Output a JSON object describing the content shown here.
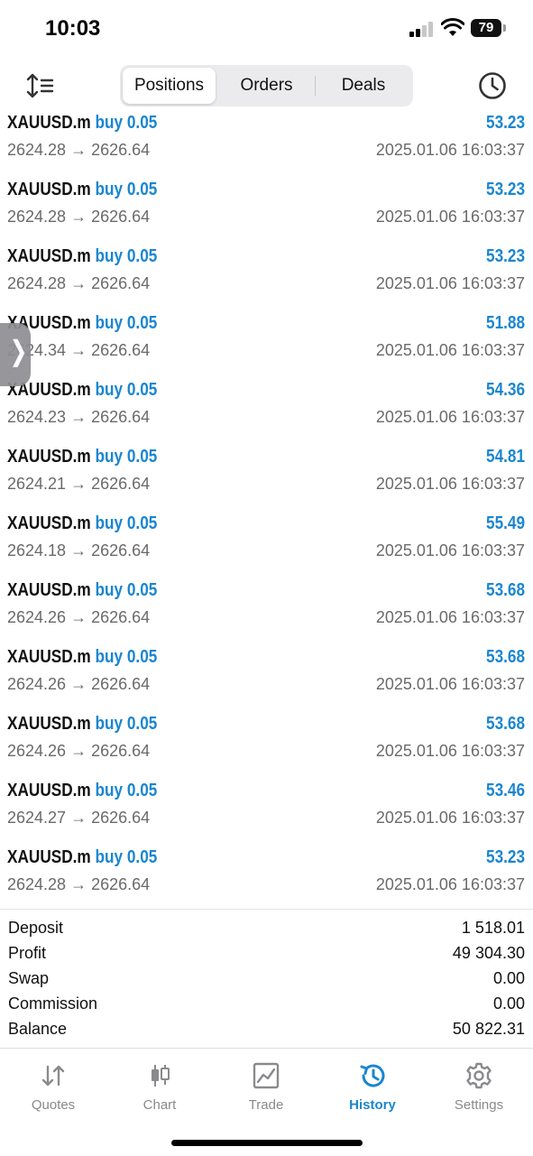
{
  "status_bar": {
    "time": "10:03",
    "battery": "79"
  },
  "toolbar": {
    "segments": [
      {
        "label": "Positions",
        "active": true
      },
      {
        "label": "Orders",
        "active": false
      },
      {
        "label": "Deals",
        "active": false
      }
    ]
  },
  "accent_color": "#1a86d0",
  "deals": [
    {
      "symbol": "XAUUSD.m",
      "side": "buy 0.05",
      "prices": "2624.28 → 2626.64",
      "profit": "53.23",
      "time": "2025.01.06 16:03:37"
    },
    {
      "symbol": "XAUUSD.m",
      "side": "buy 0.05",
      "prices": "2624.28 → 2626.64",
      "profit": "53.23",
      "time": "2025.01.06 16:03:37"
    },
    {
      "symbol": "XAUUSD.m",
      "side": "buy 0.05",
      "prices": "2624.28 → 2626.64",
      "profit": "53.23",
      "time": "2025.01.06 16:03:37"
    },
    {
      "symbol": "XAUUSD.m",
      "side": "buy 0.05",
      "prices": "2624.34 → 2626.64",
      "profit": "51.88",
      "time": "2025.01.06 16:03:37"
    },
    {
      "symbol": "XAUUSD.m",
      "side": "buy 0.05",
      "prices": "2624.23 → 2626.64",
      "profit": "54.36",
      "time": "2025.01.06 16:03:37"
    },
    {
      "symbol": "XAUUSD.m",
      "side": "buy 0.05",
      "prices": "2624.21 → 2626.64",
      "profit": "54.81",
      "time": "2025.01.06 16:03:37"
    },
    {
      "symbol": "XAUUSD.m",
      "side": "buy 0.05",
      "prices": "2624.18 → 2626.64",
      "profit": "55.49",
      "time": "2025.01.06 16:03:37"
    },
    {
      "symbol": "XAUUSD.m",
      "side": "buy 0.05",
      "prices": "2624.26 → 2626.64",
      "profit": "53.68",
      "time": "2025.01.06 16:03:37"
    },
    {
      "symbol": "XAUUSD.m",
      "side": "buy 0.05",
      "prices": "2624.26 → 2626.64",
      "profit": "53.68",
      "time": "2025.01.06 16:03:37"
    },
    {
      "symbol": "XAUUSD.m",
      "side": "buy 0.05",
      "prices": "2624.26 → 2626.64",
      "profit": "53.68",
      "time": "2025.01.06 16:03:37"
    },
    {
      "symbol": "XAUUSD.m",
      "side": "buy 0.05",
      "prices": "2624.27 → 2626.64",
      "profit": "53.46",
      "time": "2025.01.06 16:03:37"
    },
    {
      "symbol": "XAUUSD.m",
      "side": "buy 0.05",
      "prices": "2624.28 → 2626.64",
      "profit": "53.23",
      "time": "2025.01.06 16:03:37"
    }
  ],
  "summary": [
    {
      "label": "Deposit",
      "value": "1 518.01"
    },
    {
      "label": "Profit",
      "value": "49 304.30"
    },
    {
      "label": "Swap",
      "value": "0.00"
    },
    {
      "label": "Commission",
      "value": "0.00"
    },
    {
      "label": "Balance",
      "value": "50 822.31"
    }
  ],
  "tabs": [
    {
      "label": "Quotes",
      "icon": "quotes-arrows-icon",
      "active": false
    },
    {
      "label": "Chart",
      "icon": "candlestick-icon",
      "active": false
    },
    {
      "label": "Trade",
      "icon": "trade-chart-icon",
      "active": false
    },
    {
      "label": "History",
      "icon": "history-clock-icon",
      "active": true
    },
    {
      "label": "Settings",
      "icon": "gear-icon",
      "active": false
    }
  ]
}
